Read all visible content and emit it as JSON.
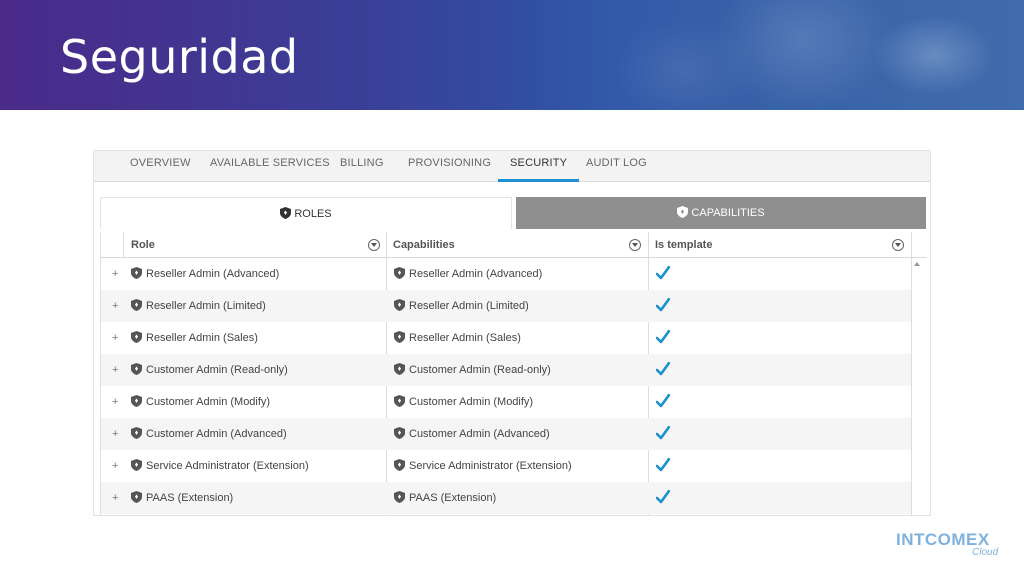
{
  "banner": {
    "title": "Seguridad"
  },
  "tabs": [
    {
      "label": "OVERVIEW",
      "active": false
    },
    {
      "label": "AVAILABLE SERVICES",
      "active": false
    },
    {
      "label": "BILLING",
      "active": false
    },
    {
      "label": "PROVISIONING",
      "active": false
    },
    {
      "label": "SECURITY",
      "active": true
    },
    {
      "label": "AUDIT LOG",
      "active": false
    }
  ],
  "subtabs": {
    "roles": "ROLES",
    "capabilities": "CAPABILITIES"
  },
  "columns": {
    "role": "Role",
    "capabilities": "Capabilities",
    "is_template": "Is template"
  },
  "rows": [
    {
      "role": "Reseller Admin (Advanced)",
      "capability": "Reseller Admin (Advanced)",
      "is_template": true
    },
    {
      "role": "Reseller Admin (Limited)",
      "capability": "Reseller Admin (Limited)",
      "is_template": true
    },
    {
      "role": "Reseller Admin (Sales)",
      "capability": "Reseller Admin (Sales)",
      "is_template": true
    },
    {
      "role": "Customer Admin (Read-only)",
      "capability": "Customer Admin (Read-only)",
      "is_template": true
    },
    {
      "role": "Customer Admin (Modify)",
      "capability": "Customer Admin (Modify)",
      "is_template": true
    },
    {
      "role": "Customer Admin (Advanced)",
      "capability": "Customer Admin (Advanced)",
      "is_template": true
    },
    {
      "role": "Service Administrator (Extension)",
      "capability": "Service Administrator (Extension)",
      "is_template": true
    },
    {
      "role": "PAAS (Extension)",
      "capability": "PAAS (Extension)",
      "is_template": true
    }
  ],
  "expander_symbol": "+",
  "logo": {
    "main": "INTCOMEX",
    "sub": "Cloud"
  },
  "colors": {
    "accent": "#1e8fd0",
    "check": "#1e8fd0",
    "subtab_inactive": "#8f8f8f"
  },
  "icons": {
    "shield": "shield-icon",
    "check": "check-icon",
    "filter": "filter-icon"
  }
}
